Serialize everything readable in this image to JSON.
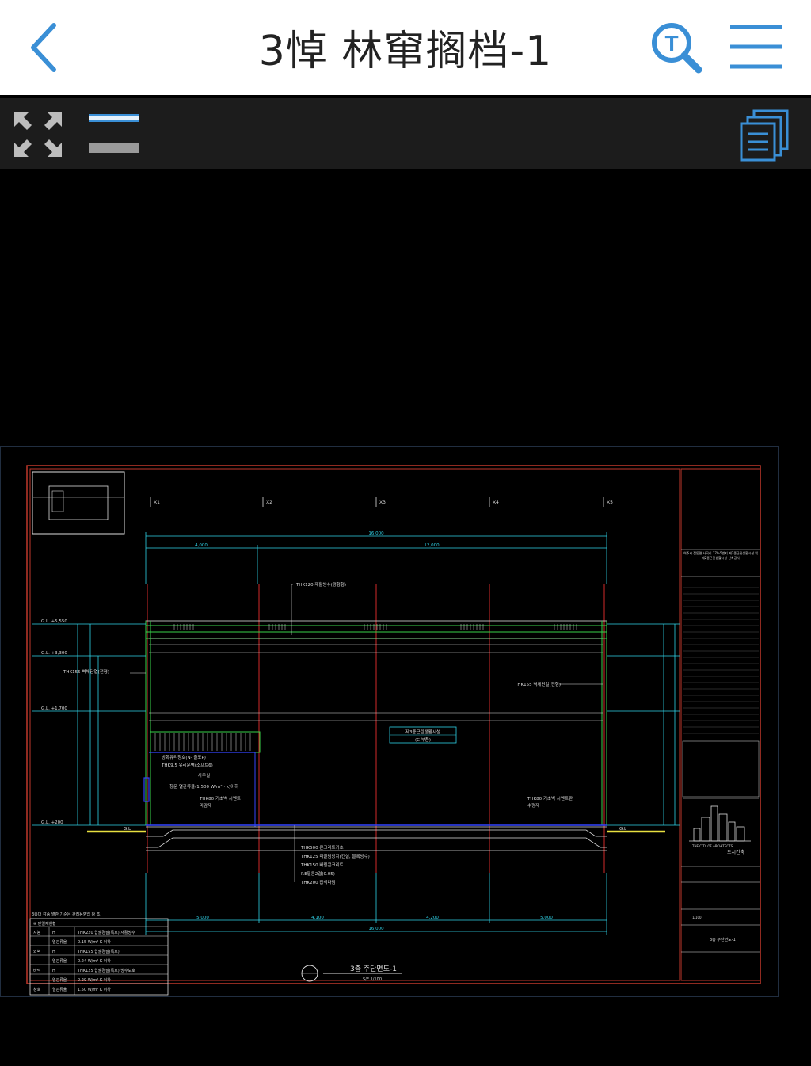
{
  "header": {
    "title": "3悼 林窜搁档-1",
    "back_icon": "chevron-left-icon",
    "search_icon": "text-search-icon",
    "menu_icon": "hamburger-menu-icon"
  },
  "toolbar": {
    "fit_icon": "expand-arrows-icon",
    "layer_icon": "layers-icon",
    "layout_icon": "document-stack-icon"
  },
  "colors": {
    "accent": "#3a8fd6",
    "cad_frame": "#c0392b",
    "cad_dim": "#2fd3e8",
    "cad_text": "#d8d8d8",
    "cad_green": "#37d24a",
    "cad_red": "#d22a2a",
    "cad_blue": "#3344ff"
  },
  "drawing": {
    "grid_labels": [
      "X1",
      "X2",
      "X3",
      "X4",
      "X5"
    ],
    "overall_dim": "16,000",
    "top_dims": [
      "4,000",
      "12,000"
    ],
    "bottom_dims": [
      "5,000",
      "4,100",
      "4,200",
      "5,000"
    ],
    "bottom_total": "16,000",
    "level_left": [
      "G.L. +5,550",
      "G.L. +3,300",
      "G.L. +1,700",
      "G.L. +200"
    ],
    "roof_note": "THK120 재활방수(평형형)",
    "left_note": "THK155 벽체단열(전형)",
    "right_note": "THK155 벽체단열(전형)",
    "center_label_1": "제3종근린생활시설",
    "center_label_2": "(C 부품)",
    "room_notes": [
      "방화유리창호(N- 줄포P)",
      "THK9.5 유리문벽(소프트6)",
      "사무실",
      "창문 열관류율(1.500 W/m² · k)이하"
    ],
    "floor_notes": [
      "THK80 기초벽 시멘트",
      "마감재"
    ],
    "floor_notes_right": [
      "THK80 기초벽 시멘트판",
      "수평재"
    ],
    "slab_notes": [
      "THK500 콘크리트기초",
      "THK125 미끌림방지(건설, 블록방수)",
      "THK150 버림콘크리트",
      "P.E필름2겹(0.05)",
      "THK200 잡석다짐"
    ],
    "left_gl": "G.L",
    "right_gl": "G.L",
    "sheet_title": "3층 주단면도-1",
    "sheet_scale": "S/E 1/100",
    "legend_title": "※ 단열재현황",
    "legend_note": "3층대 각종 열관 기준은 관리용영업 참 조.",
    "legend_rows": [
      [
        "지붕",
        "H",
        "THK220 압출경질(특호) 재활방수"
      ],
      [
        "",
        "열관류율",
        "0.15 W/m² K 이하"
      ],
      [
        "외벽",
        "H",
        "THK155 압출경질(특호)"
      ],
      [
        "",
        "열관류율",
        "0.24 W/m² K 이하"
      ],
      [
        "바닥",
        "H",
        "THK125 압출경질(특호) 방수보호"
      ],
      [
        "",
        "열관류율",
        "0.29 W/m² K 이하"
      ],
      [
        "창호",
        "열관류율",
        "1.50 W/m² K 이하"
      ]
    ],
    "tb_project": "여주시 점동면 사곡리 179-5번지 제3종근린생활시설 및 제2종근린생활시설 신축공사",
    "tb_company": "도시건축",
    "tb_company_en": "THE CITY OF ARCHITECTS",
    "tb_drawing_name": "3층 주단면도-1",
    "tb_scale": "1/100"
  }
}
